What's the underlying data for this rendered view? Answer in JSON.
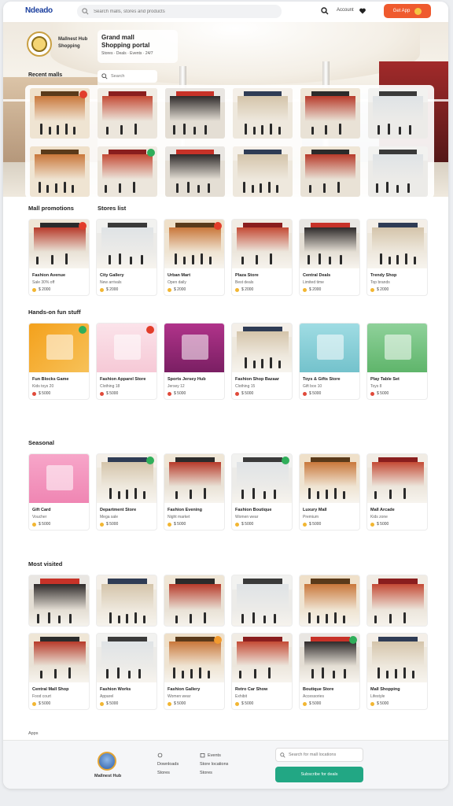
{
  "header": {
    "logo": "Ndeado",
    "search_placeholder": "Search malls, stores and products",
    "account_label": "Account",
    "cta_label": "Get App",
    "colors": {
      "brand": "#1b3f9e",
      "accent": "#ef5a2e"
    }
  },
  "hero": {
    "brand_name": "Mallnest Hub",
    "brand_name_line2": "Shopping",
    "card_title": "Grand mall",
    "card_title_line2": "Shopping portal",
    "card_subtitle": "Stores · Deals · Events · 24/7",
    "section_title": "Recent malls",
    "search_placeholder": "Search"
  },
  "sections": [
    {
      "title": "Mall promotions",
      "side_label": "Stores list",
      "cards": [
        {
          "name": "Fashion Avenue",
          "sub": "Sale 30% off",
          "price": "$ 2000"
        },
        {
          "name": "City Gallery",
          "sub": "New arrivals",
          "price": "$ 2000"
        },
        {
          "name": "Urban Mart",
          "sub": "Open daily",
          "price": "$ 2000"
        },
        {
          "name": "Plaza Store",
          "sub": "Best deals",
          "price": "$ 2000"
        },
        {
          "name": "Central Deals",
          "sub": "Limited time",
          "price": "$ 2000"
        },
        {
          "name": "Trendy Shop",
          "sub": "Top brands",
          "price": "$ 2000"
        }
      ]
    },
    {
      "title": "Hands-on fun stuff",
      "cards": [
        {
          "name": "Fun Blocks Game",
          "sub": "Kids toys 20",
          "price": "$ 5000"
        },
        {
          "name": "Fashion Apparel Store",
          "sub": "Clothing 18",
          "price": "$ 5000"
        },
        {
          "name": "Sports Jersey Hub",
          "sub": "Jersey 12",
          "price": "$ 5000"
        },
        {
          "name": "Fashion Shop Bazaar",
          "sub": "Clothing 15",
          "price": "$ 5000"
        },
        {
          "name": "Toys & Gifts Store",
          "sub": "Gift box 10",
          "price": "$ 5000"
        },
        {
          "name": "Play Table Set",
          "sub": "Toys 8",
          "price": "$ 5000"
        }
      ]
    },
    {
      "title": "Seasonal",
      "cards": [
        {
          "name": "Gift Card",
          "sub": "Voucher",
          "price": "$ 5000"
        },
        {
          "name": "Department Store",
          "sub": "Mega sale",
          "price": "$ 5000"
        },
        {
          "name": "Fashion Evening",
          "sub": "Night market",
          "price": "$ 5000"
        },
        {
          "name": "Fashion Boutique",
          "sub": "Women wear",
          "price": "$ 5000"
        },
        {
          "name": "Luxury Mall",
          "sub": "Premium",
          "price": "$ 5000"
        },
        {
          "name": "Mall Arcade",
          "sub": "Kids zone",
          "price": "$ 5000"
        }
      ]
    },
    {
      "title": "Most visited",
      "cards": [
        {
          "name": "Central Mall Shop",
          "sub": "Food court",
          "price": "$ 5000"
        },
        {
          "name": "Fashion Works",
          "sub": "Apparel",
          "price": "$ 5000"
        },
        {
          "name": "Fashion Gallery",
          "sub": "Women wear",
          "price": "$ 5000"
        },
        {
          "name": "Retro Car Show",
          "sub": "Exhibit",
          "price": "$ 5000"
        },
        {
          "name": "Boutique Store",
          "sub": "Accessories",
          "price": "$ 5000"
        },
        {
          "name": "Mall Shopping",
          "sub": "Lifestyle",
          "price": "$ 5000"
        }
      ]
    }
  ],
  "footer": {
    "label": "Apps",
    "brand": "Mallnest Hub",
    "col1": [
      "Downloads",
      "Stores"
    ],
    "col2": [
      "Events",
      "Store locations",
      "Stores"
    ],
    "input_placeholder": "Search for mall locations",
    "button_label": "Subscribe for deals"
  }
}
